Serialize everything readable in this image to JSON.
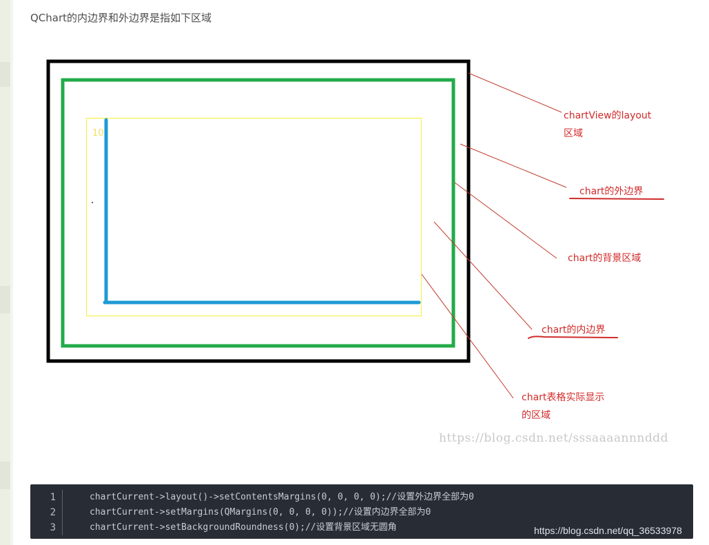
{
  "heading": "QChart的内边界和外边界是指如下区域",
  "diagram": {
    "axis_tick": "10",
    "labels": {
      "layout_line1": "chartView的layout",
      "layout_line2": "区域",
      "outer_margin": "chart的外边界",
      "background_area": "chart的背景区域",
      "inner_margin": "chart的内边界",
      "plot_line1": "chart表格实际显示",
      "plot_line2": "的区域"
    },
    "colors": {
      "layout_border": "#000000",
      "outer_border": "#22ab4a",
      "inner_border": "#f5ef3c",
      "axes": "#1e9ad6",
      "annotation": "#d12a2a"
    },
    "watermark": "https://blog.csdn.net/sssaaaannnddd"
  },
  "code": {
    "lines": [
      {
        "num": "1",
        "text": "chartCurrent->layout()->setContentsMargins(0, 0, 0, 0);//设置外边界全部为0"
      },
      {
        "num": "2",
        "text": "chartCurrent->setMargins(QMargins(0, 0, 0, 0));//设置内边界全部为0"
      },
      {
        "num": "3",
        "text": "chartCurrent->setBackgroundRoundness(0);//设置背景区域无圆角"
      }
    ]
  },
  "watermark_bottom": "https://blog.csdn.net/qq_36533978"
}
